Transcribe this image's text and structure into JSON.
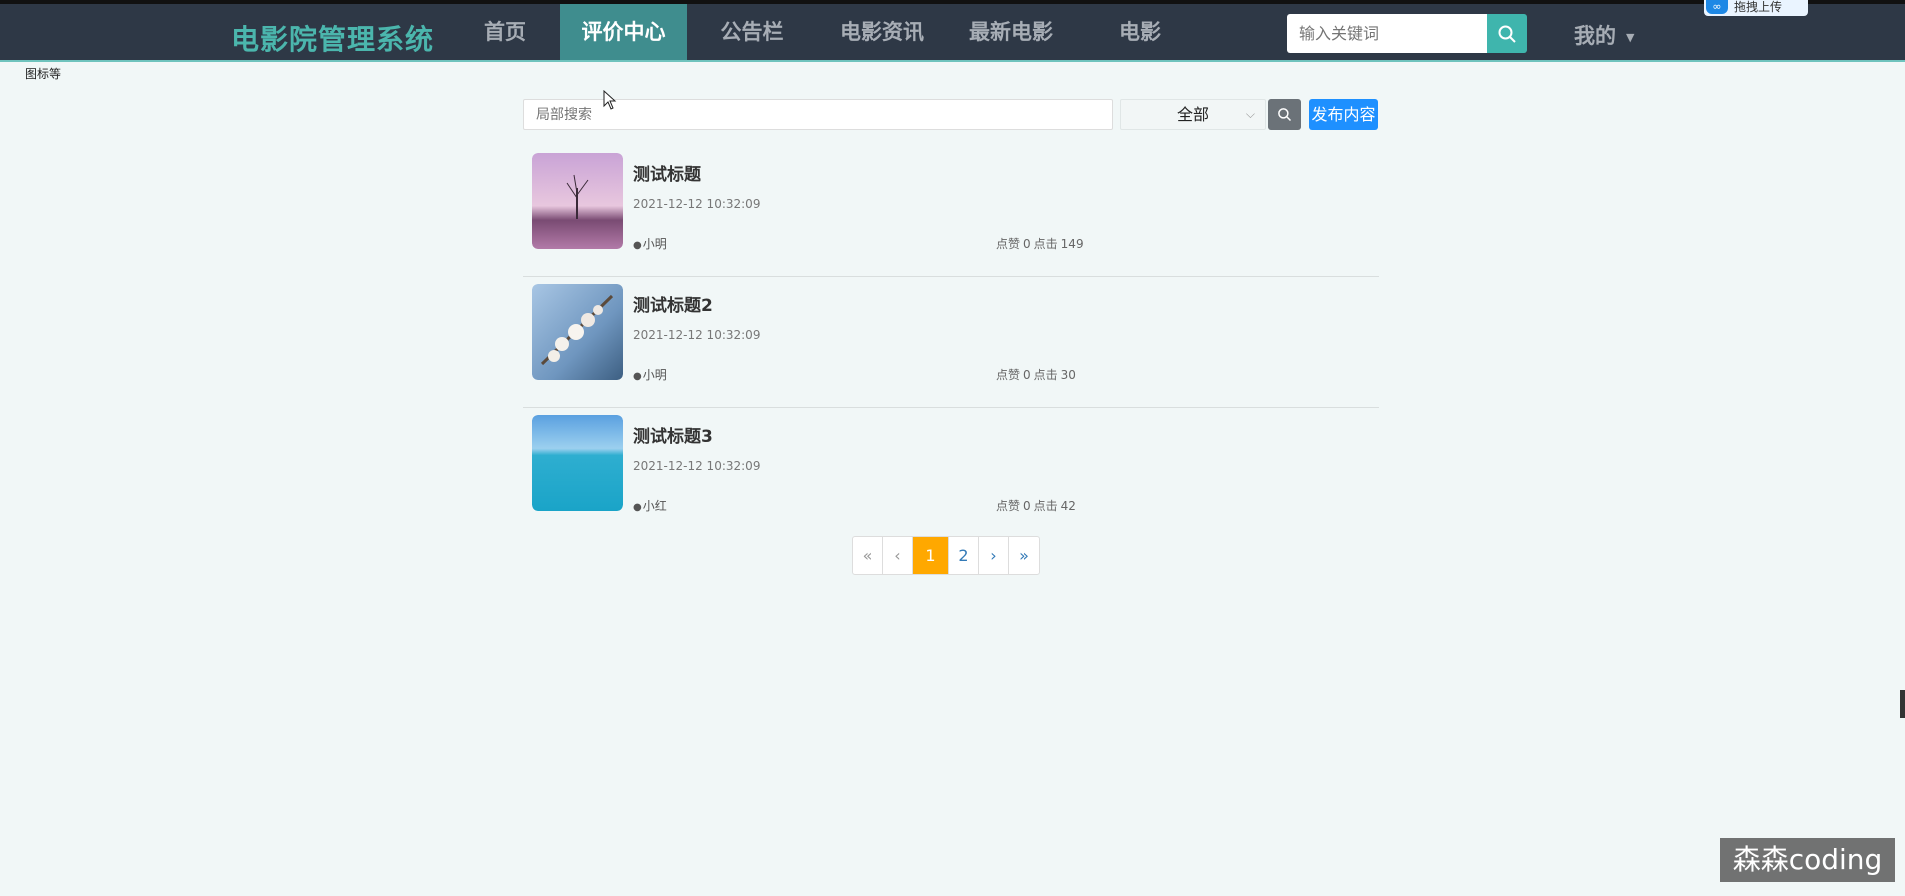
{
  "header": {
    "brand": "电影院管理系统",
    "nav": [
      {
        "label": "首页",
        "active": false
      },
      {
        "label": "评价中心",
        "active": true
      },
      {
        "label": "公告栏",
        "active": false
      },
      {
        "label": "电影资讯",
        "active": false
      },
      {
        "label": "最新电影",
        "active": false
      },
      {
        "label": "电影",
        "active": false
      }
    ],
    "search_placeholder": "输入关键词",
    "mine_label": "我的",
    "upload_chip": "拖拽上传"
  },
  "corner_label": "图标等",
  "filter": {
    "search_placeholder": "局部搜索",
    "select_value": "全部",
    "publish_label": "发布内容"
  },
  "posts": [
    {
      "title": "测试标题",
      "date": "2021-12-12 10:32:09",
      "author": "小明",
      "likes_label": "点赞",
      "likes": "0",
      "clicks_label": "点击",
      "clicks": "149"
    },
    {
      "title": "测试标题2",
      "date": "2021-12-12 10:32:09",
      "author": "小明",
      "likes_label": "点赞",
      "likes": "0",
      "clicks_label": "点击",
      "clicks": "30"
    },
    {
      "title": "测试标题3",
      "date": "2021-12-12 10:32:09",
      "author": "小红",
      "likes_label": "点赞",
      "likes": "0",
      "clicks_label": "点击",
      "clicks": "42"
    }
  ],
  "pagination": {
    "first": "«",
    "prev": "‹",
    "pages": [
      "1",
      "2"
    ],
    "current": "1",
    "next": "›",
    "last": "»"
  },
  "watermark": "森森coding",
  "colors": {
    "topbar": "#2e3846",
    "brand": "#4bb6ad",
    "nav_active": "#3f8d8e",
    "search_button": "#3fb5ad",
    "publish_button": "#1e90ff",
    "page_active": "#ffa800",
    "background": "#f1f7f7"
  }
}
